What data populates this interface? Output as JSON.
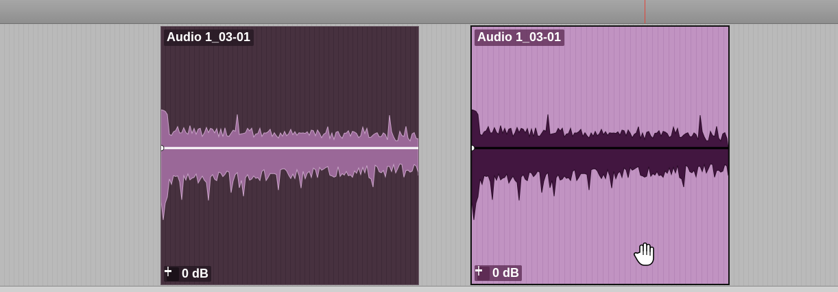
{
  "regions": [
    {
      "name": "Audio 1_03-01",
      "gain": "0 dB",
      "selected": false,
      "colors": {
        "background": "#47313f",
        "waveform": "#9a6898",
        "waveform_edge": "#c9a3c8",
        "centerline": "#ffffff"
      }
    },
    {
      "name": "Audio 1_03-01",
      "gain": "0 dB",
      "selected": true,
      "colors": {
        "background": "#c193c2",
        "waveform": "#421640",
        "waveform_edge": "#2a0c28",
        "centerline": "#000000"
      }
    }
  ],
  "icons": {
    "gain": "fader-icon",
    "cursor": "hand-cursor-icon"
  },
  "colors": {
    "playhead": "#e0443a",
    "lane": "#b9b9b9"
  }
}
